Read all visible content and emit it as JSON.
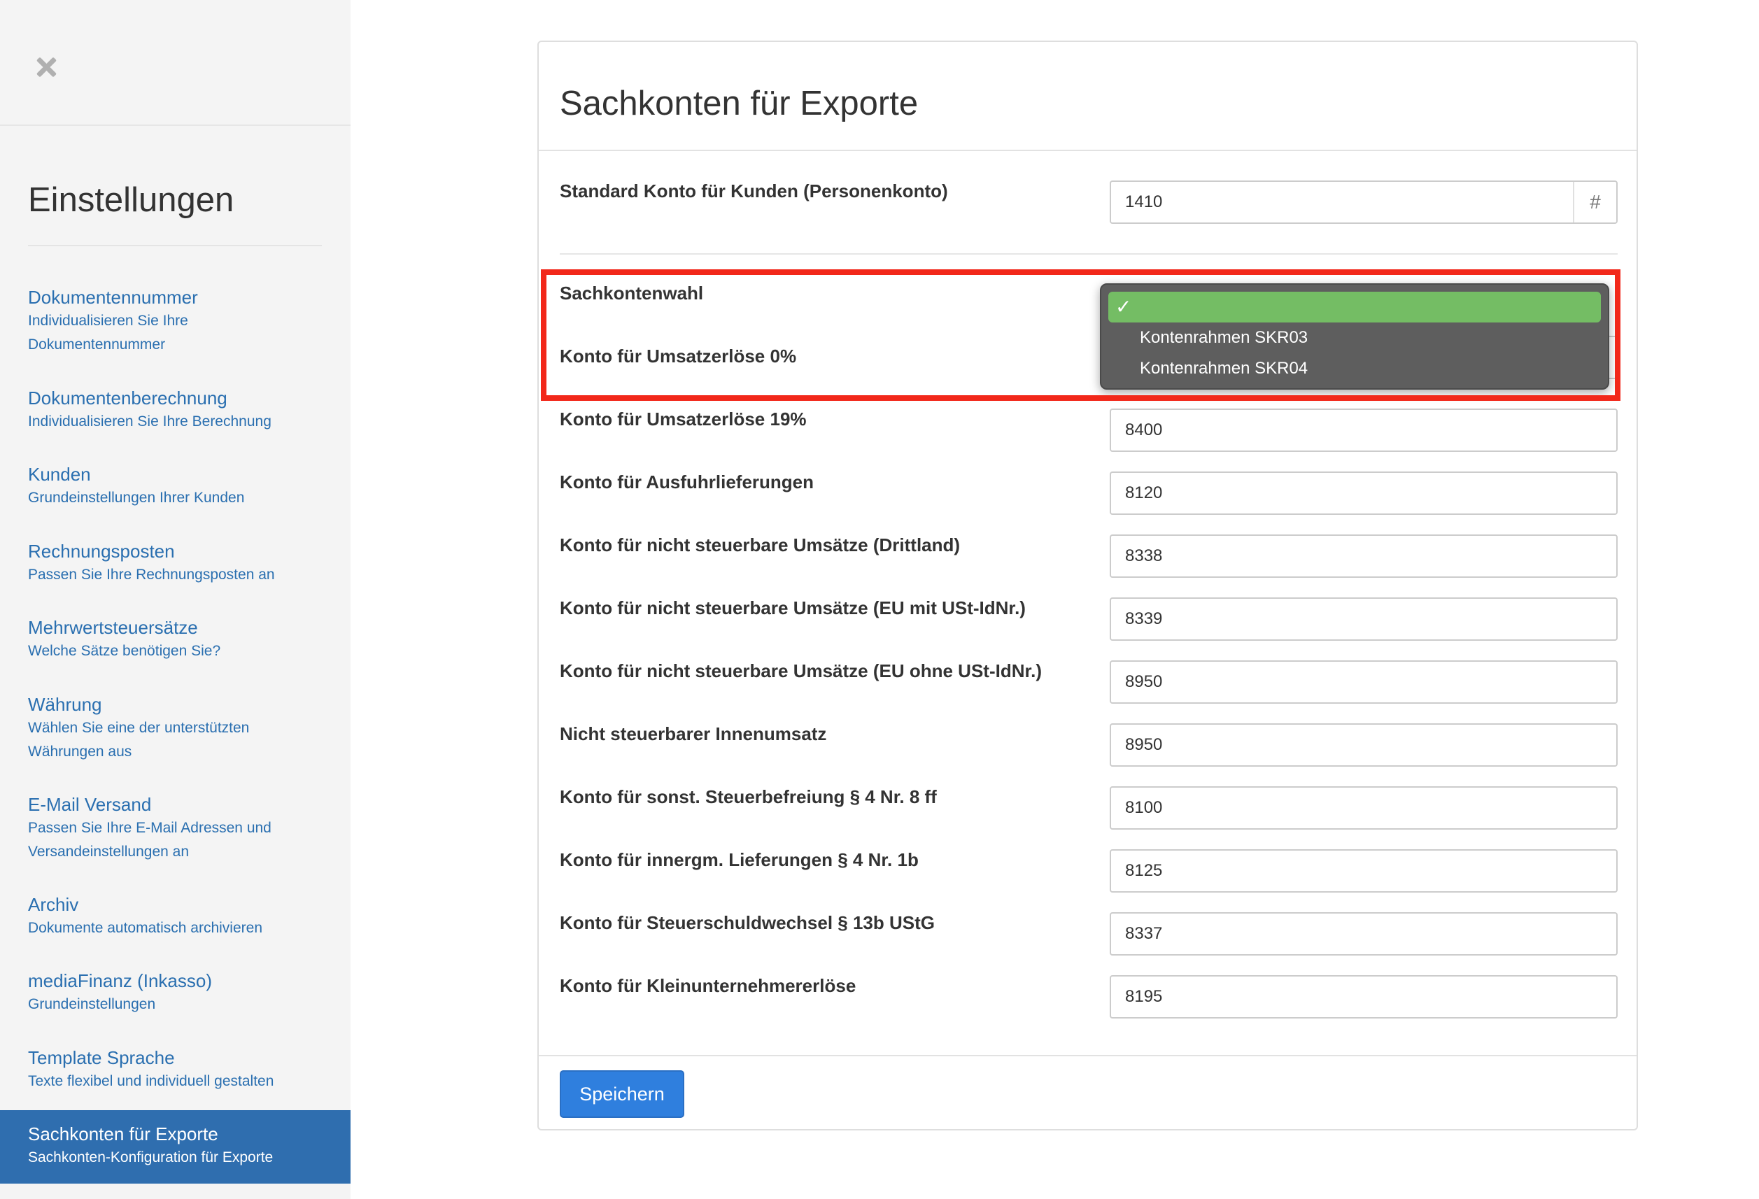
{
  "sidebar": {
    "title": "Einstellungen",
    "items": [
      {
        "title": "Dokumentennummer",
        "subtitle": "Individualisieren Sie Ihre Dokumentennummer",
        "active": false
      },
      {
        "title": "Dokumentenberechnung",
        "subtitle": "Individualisieren Sie Ihre Berechnung",
        "active": false
      },
      {
        "title": "Kunden",
        "subtitle": "Grundeinstellungen Ihrer Kunden",
        "active": false
      },
      {
        "title": "Rechnungsposten",
        "subtitle": "Passen Sie Ihre Rechnungsposten an",
        "active": false
      },
      {
        "title": "Mehrwertsteuersätze",
        "subtitle": "Welche Sätze benötigen Sie?",
        "active": false
      },
      {
        "title": "Währung",
        "subtitle": "Wählen Sie eine der unterstützten Währungen aus",
        "active": false
      },
      {
        "title": "E-Mail Versand",
        "subtitle": "Passen Sie Ihre E-Mail Adressen und Versandeinstellungen an",
        "active": false
      },
      {
        "title": "Archiv",
        "subtitle": "Dokumente automatisch archivieren",
        "active": false
      },
      {
        "title": "mediaFinanz (Inkasso)",
        "subtitle": "Grundeinstellungen",
        "active": false
      },
      {
        "title": "Template Sprache",
        "subtitle": "Texte flexibel und individuell gestalten",
        "active": false
      },
      {
        "title": "Sachkonten für Exporte",
        "subtitle": "Sachkonten-Konfiguration für Exporte",
        "active": true
      }
    ]
  },
  "panel": {
    "title": "Sachkonten für Exporte",
    "customer_account": {
      "label": "Standard Konto für Kunden (Personenkonto)",
      "value": "1410",
      "addon": "#"
    },
    "chart_select": {
      "label": "Sachkontenwahl",
      "options": [
        {
          "label": "",
          "selected": true,
          "check": "✓"
        },
        {
          "label": "Kontenrahmen SKR03",
          "selected": false
        },
        {
          "label": "Kontenrahmen SKR04",
          "selected": false
        }
      ]
    },
    "accounts": [
      {
        "label": "Konto für Umsatzerlöse 0%",
        "value": ""
      },
      {
        "label": "Konto für Umsatzerlöse 19%",
        "value": "8400"
      },
      {
        "label": "Konto für Ausfuhrlieferungen",
        "value": "8120"
      },
      {
        "label": "Konto für nicht steuerbare Umsätze (Drittland)",
        "value": "8338"
      },
      {
        "label": "Konto für nicht steuerbare Umsätze (EU mit USt-IdNr.)",
        "value": "8339"
      },
      {
        "label": "Konto für nicht steuerbare Umsätze (EU ohne USt-IdNr.)",
        "value": "8950"
      },
      {
        "label": "Nicht steuerbarer Innenumsatz",
        "value": "8950"
      },
      {
        "label": "Konto für sonst. Steuerbefreiung § 4 Nr. 8 ff",
        "value": "8100"
      },
      {
        "label": "Konto für innergm. Lieferungen § 4 Nr. 1b",
        "value": "8125"
      },
      {
        "label": "Konto für Steuerschuldwechsel § 13b UStG",
        "value": "8337"
      },
      {
        "label": "Konto für Kleinunternehmererlöse",
        "value": "8195"
      }
    ],
    "save_label": "Speichern"
  },
  "colors": {
    "accent": "#2f7fde",
    "sidebar_active": "#2f6eaf",
    "link": "#2a6fb0",
    "dropdown_bg": "#5e5e5e",
    "dropdown_selected": "#74bd64",
    "highlight": "#f2281a"
  }
}
